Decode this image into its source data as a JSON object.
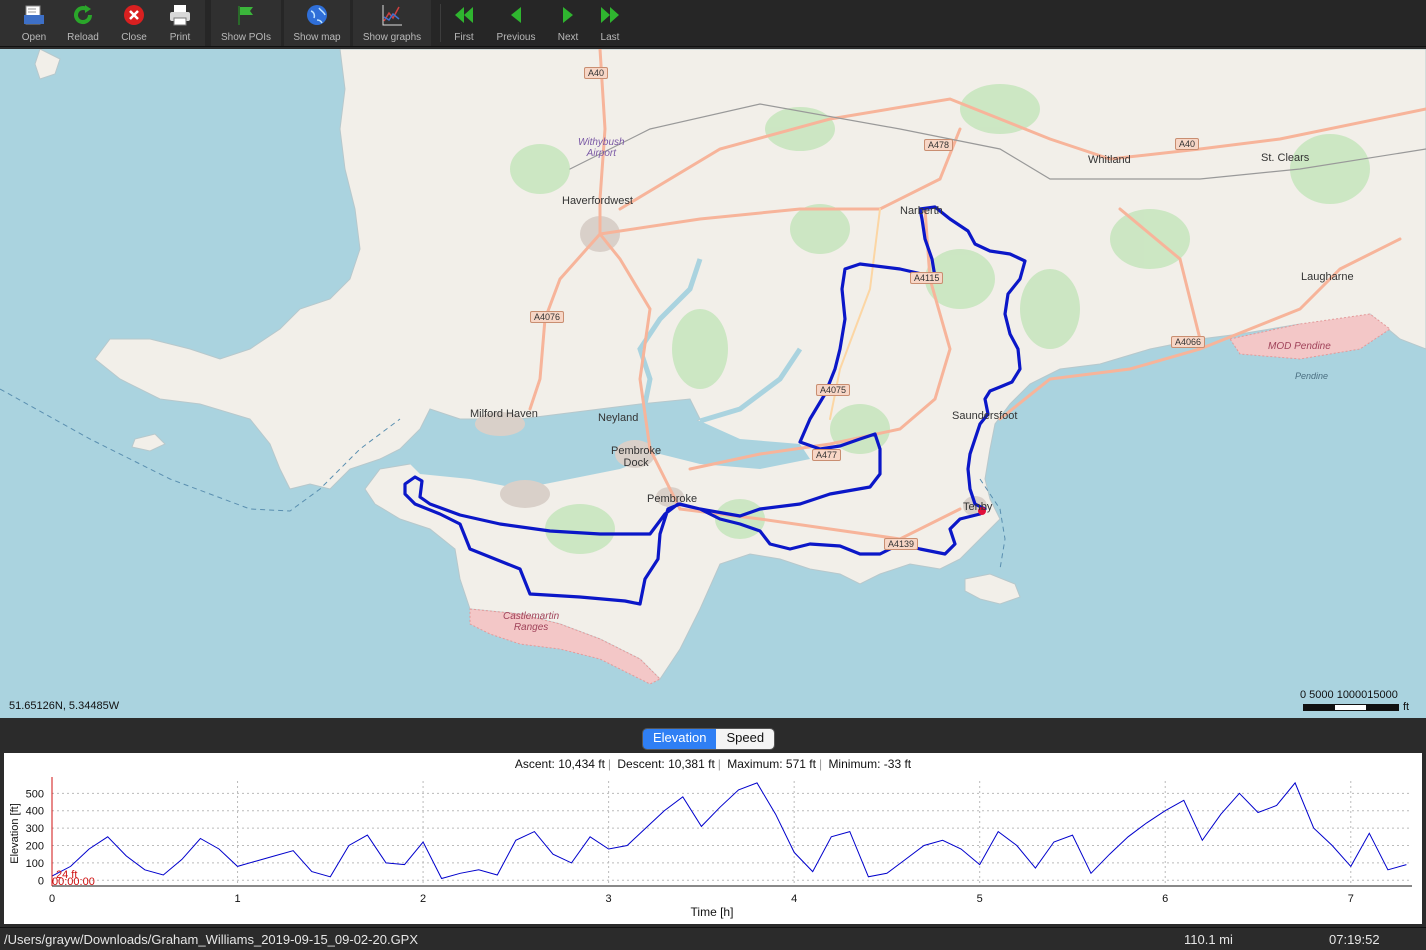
{
  "toolbar": {
    "open": "Open",
    "reload": "Reload",
    "close": "Close",
    "print": "Print",
    "show_pois": "Show POIs",
    "show_map": "Show map",
    "show_graphs": "Show graphs",
    "first": "First",
    "previous": "Previous",
    "next": "Next",
    "last": "Last"
  },
  "map": {
    "places": {
      "haverfordwest": "Haverfordwest",
      "withybush": "Withybush\nAirport",
      "whitland": "Whitland",
      "st_clears": "St. Clears",
      "narberth": "Narberth",
      "laugharne": "Laugharne",
      "milford_haven": "Milford Haven",
      "neyland": "Neyland",
      "pembroke_dock": "Pembroke\nDock",
      "pembroke": "Pembroke",
      "saundersfoot": "Saundersfoot",
      "tenby": "Tenby",
      "castlemartin": "Castlemartin\nRanges",
      "mod_pendine": "MOD Pendine",
      "pendine": "Pendine"
    },
    "roads": {
      "a40_top": "A40",
      "a478": "A478",
      "a40_right": "A40",
      "a4075": "A4075",
      "a4115": "A4115",
      "a4076": "A4076",
      "a477": "A477",
      "a4139": "A4139",
      "a4066": "A4066"
    },
    "coordinates": "51.65126N, 5.34485W",
    "scale": {
      "labels": "0     5000 1000015000",
      "unit": "ft"
    },
    "colors": {
      "sea": "#aad3df",
      "land": "#f2efe9",
      "track": "#0b17c8",
      "road": "#f7b49a",
      "military": "#f3c7c7"
    }
  },
  "graph_tabs": {
    "elevation": "Elevation",
    "speed": "Speed",
    "active": "Elevation"
  },
  "stats": {
    "ascent": "Ascent: 10,434 ft",
    "descent": "Descent: 10,381 ft",
    "maximum": "Maximum: 571 ft",
    "minimum": "Minimum: -33 ft"
  },
  "chart_data": {
    "type": "line",
    "xlabel": "Time [h]",
    "ylabel": "Elevation [ft]",
    "xlim": [
      0,
      7.33
    ],
    "ylim": [
      -33,
      571
    ],
    "x_ticks": [
      0,
      1,
      2,
      3,
      4,
      5,
      6,
      7
    ],
    "y_ticks": [
      0,
      100,
      200,
      300,
      400,
      500
    ],
    "grid": true,
    "slider_labels": {
      "value": "24 ft",
      "time": "00:00:00"
    },
    "series": [
      {
        "color": "#0000cc",
        "x": [
          0,
          0.1,
          0.2,
          0.3,
          0.4,
          0.5,
          0.6,
          0.7,
          0.8,
          0.9,
          1.0,
          1.1,
          1.2,
          1.3,
          1.4,
          1.5,
          1.6,
          1.7,
          1.8,
          1.9,
          2.0,
          2.1,
          2.2,
          2.3,
          2.4,
          2.5,
          2.6,
          2.7,
          2.8,
          2.9,
          3.0,
          3.1,
          3.2,
          3.3,
          3.4,
          3.5,
          3.6,
          3.7,
          3.8,
          3.9,
          4.0,
          4.1,
          4.2,
          4.3,
          4.4,
          4.5,
          4.6,
          4.7,
          4.8,
          4.9,
          5.0,
          5.1,
          5.2,
          5.3,
          5.4,
          5.5,
          5.6,
          5.7,
          5.8,
          5.9,
          6.0,
          6.1,
          6.2,
          6.3,
          6.4,
          6.5,
          6.6,
          6.7,
          6.8,
          6.9,
          7.0,
          7.1,
          7.2,
          7.3
        ],
        "y": [
          24,
          80,
          180,
          250,
          140,
          60,
          30,
          120,
          240,
          180,
          80,
          110,
          140,
          170,
          50,
          20,
          200,
          260,
          100,
          90,
          220,
          10,
          40,
          60,
          30,
          230,
          280,
          150,
          100,
          250,
          180,
          200,
          300,
          400,
          480,
          310,
          420,
          520,
          560,
          380,
          160,
          50,
          250,
          280,
          20,
          40,
          120,
          200,
          230,
          180,
          90,
          280,
          200,
          70,
          220,
          260,
          40,
          150,
          250,
          330,
          400,
          460,
          230,
          380,
          500,
          390,
          430,
          560,
          300,
          200,
          80,
          270,
          60,
          90
        ]
      }
    ]
  },
  "status": {
    "file_path": "/Users/grayw/Downloads/Graham_Williams_2019-09-15_09-02-20.GPX",
    "distance": "110.1 mi",
    "duration": "07:19:52"
  }
}
